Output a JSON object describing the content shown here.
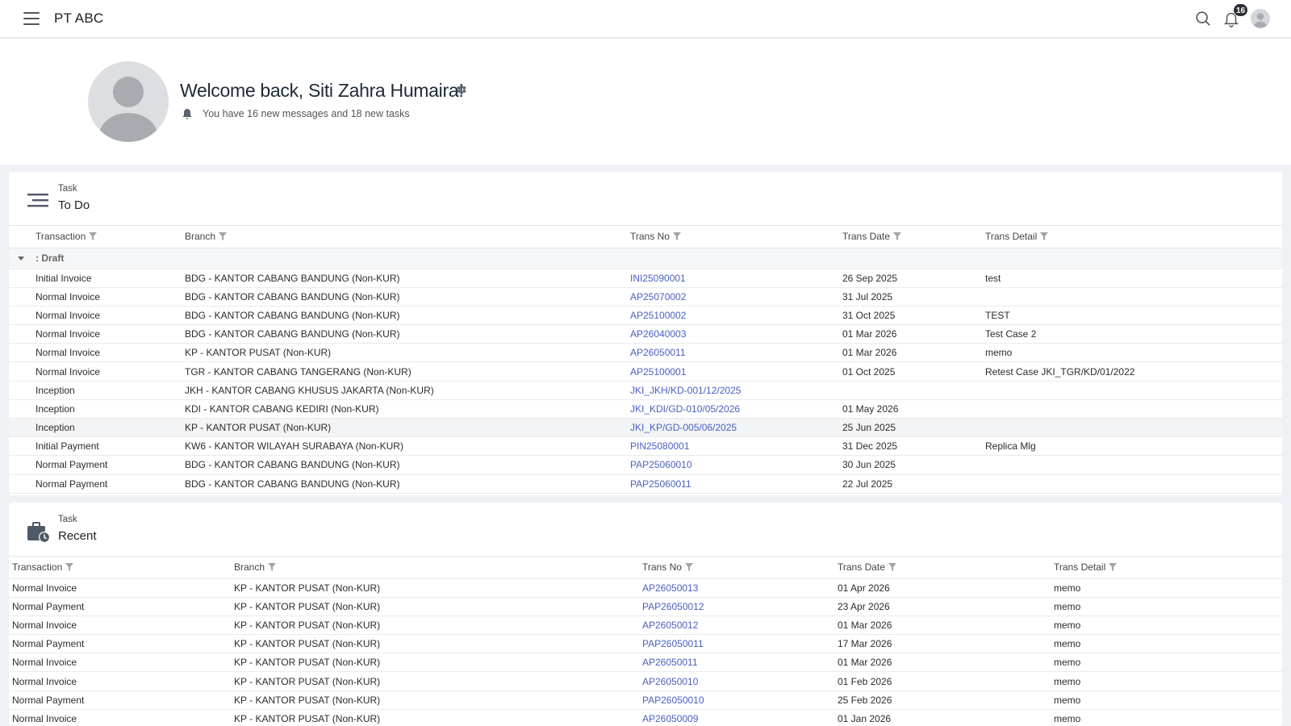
{
  "app": {
    "title": "PT ABC",
    "notification_count": "16"
  },
  "welcome": {
    "title": "Welcome back, Siti Zahra Humaira!",
    "subtitle": "You have 16 new messages and 18 new tasks"
  },
  "todo": {
    "small_title": "Task",
    "title": "To Do",
    "columns": [
      "Transaction",
      "Branch",
      "Trans No",
      "Trans Date",
      "Trans Detail"
    ],
    "group_label": ": Draft",
    "rows": [
      [
        "Initial Invoice",
        "BDG - KANTOR CABANG BANDUNG (Non-KUR)",
        "INI25090001",
        "26 Sep 2025",
        "test"
      ],
      [
        "Normal Invoice",
        "BDG - KANTOR CABANG BANDUNG (Non-KUR)",
        "AP25070002",
        "31 Jul 2025",
        ""
      ],
      [
        "Normal Invoice",
        "BDG - KANTOR CABANG BANDUNG (Non-KUR)",
        "AP25100002",
        "31 Oct 2025",
        "TEST"
      ],
      [
        "Normal Invoice",
        "BDG - KANTOR CABANG BANDUNG (Non-KUR)",
        "AP26040003",
        "01 Mar 2026",
        "Test Case 2"
      ],
      [
        "Normal Invoice",
        "KP - KANTOR PUSAT (Non-KUR)",
        "AP26050011",
        "01 Mar 2026",
        "memo"
      ],
      [
        "Normal Invoice",
        "TGR - KANTOR CABANG TANGERANG (Non-KUR)",
        "AP25100001",
        "01 Oct 2025",
        "Retest Case JKI_TGR/KD/01/2022"
      ],
      [
        "Inception",
        "JKH - KANTOR CABANG KHUSUS JAKARTA (Non-KUR)",
        "JKI_JKH/KD-001/12/2025",
        "",
        ""
      ],
      [
        "Inception",
        "KDI - KANTOR CABANG KEDIRI (Non-KUR)",
        "JKI_KDI/GD-010/05/2026",
        "01 May 2026",
        ""
      ],
      [
        "Inception",
        "KP - KANTOR PUSAT (Non-KUR)",
        "JKI_KP/GD-005/06/2025",
        "25 Jun 2025",
        ""
      ],
      [
        "Initial Payment",
        "KW6 - KANTOR WILAYAH SURABAYA (Non-KUR)",
        "PIN25080001",
        "31 Dec 2025",
        "Replica Mlg"
      ],
      [
        "Normal Payment",
        "BDG - KANTOR CABANG BANDUNG (Non-KUR)",
        "PAP25060010",
        "30 Jun 2025",
        ""
      ],
      [
        "Normal Payment",
        "BDG - KANTOR CABANG BANDUNG (Non-KUR)",
        "PAP25060011",
        "22 Jul 2025",
        ""
      ]
    ]
  },
  "recent": {
    "small_title": "Task",
    "title": "Recent",
    "columns": [
      "Transaction",
      "Branch",
      "Trans No",
      "Trans Date",
      "Trans Detail"
    ],
    "rows": [
      [
        "Normal Invoice",
        "KP - KANTOR PUSAT (Non-KUR)",
        "AP26050013",
        "01 Apr 2026",
        "memo"
      ],
      [
        "Normal Payment",
        "KP - KANTOR PUSAT (Non-KUR)",
        "PAP26050012",
        "23 Apr 2026",
        "memo"
      ],
      [
        "Normal Invoice",
        "KP - KANTOR PUSAT (Non-KUR)",
        "AP26050012",
        "01 Mar 2026",
        "memo"
      ],
      [
        "Normal Payment",
        "KP - KANTOR PUSAT (Non-KUR)",
        "PAP26050011",
        "17 Mar 2026",
        "memo"
      ],
      [
        "Normal Invoice",
        "KP - KANTOR PUSAT (Non-KUR)",
        "AP26050011",
        "01 Mar 2026",
        "memo"
      ],
      [
        "Normal Invoice",
        "KP - KANTOR PUSAT (Non-KUR)",
        "AP26050010",
        "01 Feb 2026",
        "memo"
      ],
      [
        "Normal Payment",
        "KP - KANTOR PUSAT (Non-KUR)",
        "PAP26050010",
        "25 Feb 2026",
        "memo"
      ],
      [
        "Normal Invoice",
        "KP - KANTOR PUSAT (Non-KUR)",
        "AP26050009",
        "01 Jan 2026",
        "memo"
      ]
    ]
  },
  "colors": {
    "link": "#4a5fc1",
    "accent_dark": "#2b2f36",
    "avatar": "#c8cbd0"
  },
  "icons": [
    "menu-icon",
    "search-icon",
    "bell-icon",
    "user-avatar-icon",
    "gear-icon",
    "list-icon",
    "briefcase-clock-icon",
    "filter-icon"
  ]
}
